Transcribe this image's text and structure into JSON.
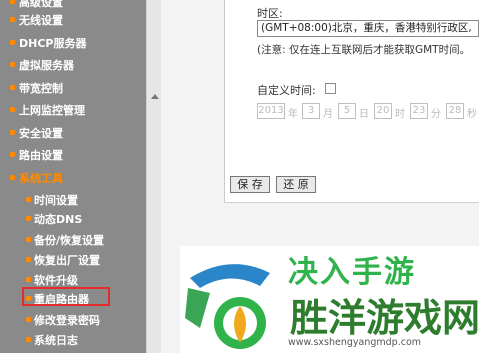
{
  "sidebar": {
    "items": [
      {
        "label": "高级设置"
      },
      {
        "label": "无线设置"
      },
      {
        "label": "DHCP服务器"
      },
      {
        "label": "虚拟服务器"
      },
      {
        "label": "带宽控制"
      },
      {
        "label": "上网监控管理"
      },
      {
        "label": "安全设置"
      },
      {
        "label": "路由设置"
      },
      {
        "label": "系统工具"
      }
    ],
    "sub_items": [
      {
        "label": "时间设置"
      },
      {
        "label": "动态DNS"
      },
      {
        "label": "备份/恢复设置"
      },
      {
        "label": "恢复出厂设置"
      },
      {
        "label": "软件升级"
      },
      {
        "label": "重启路由器"
      },
      {
        "label": "修改登录密码"
      },
      {
        "label": "系统日志"
      }
    ]
  },
  "time_settings": {
    "timezone_label": "时区:",
    "timezone_value": "(GMT+08:00)北京，重庆，香港特别行政区,",
    "note": "(注意: 仅在连上互联网后才能获取GMT时间。",
    "custom_time_label": "自定义时间:",
    "custom_time_checked": false,
    "fields": {
      "year": "2013",
      "year_unit": "年",
      "month": "3",
      "month_unit": "月",
      "day": "5",
      "day_unit": "日",
      "hour": "20",
      "hour_unit": "时",
      "minute": "23",
      "minute_unit": "分",
      "second": "28",
      "second_unit": "秒"
    }
  },
  "buttons": {
    "save": "保 存",
    "restore": "还 原"
  },
  "watermark": {
    "line1": "决入手游",
    "line2": "胜洋游戏网",
    "url": "www.sxshengyangmdp.com"
  },
  "colors": {
    "accent": "#ff8a00",
    "highlight_box": "#e52b2b",
    "sidebar_bg": "#8a8a8a"
  }
}
